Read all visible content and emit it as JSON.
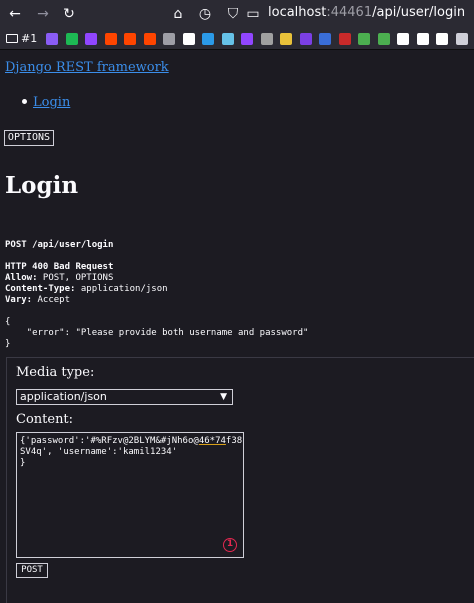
{
  "browser": {
    "url_host": "localhost",
    "url_port": ":44461",
    "url_path": "/api/user/login",
    "bookmark_folder": "#1",
    "favicon_colors": [
      "#8a5cf5",
      "#1db954",
      "#9146ff",
      "#ff4500",
      "#ff4500",
      "#ff4500",
      "#9e9ea6",
      "#ffffff",
      "#2b9ae8",
      "#66c2e8",
      "#9146ff",
      "#a0a0a0",
      "#e8c13a",
      "#7b3fe4",
      "#3a6ed8",
      "#c92a2a",
      "#4caf50",
      "#4caf50",
      "#ffffff",
      "#ffffff",
      "#ffffff",
      "#cfcfd8"
    ]
  },
  "page": {
    "brand": "Django REST framework",
    "breadcrumb": "Login",
    "options_button": "OPTIONS",
    "title": "Login",
    "request_line": "POST /api/user/login",
    "status_line": "HTTP 400 Bad Request",
    "headers": [
      {
        "key": "Allow:",
        "value": " POST, OPTIONS"
      },
      {
        "key": "Content-Type:",
        "value": " application/json"
      },
      {
        "key": "Vary:",
        "value": " Accept"
      }
    ],
    "body_open": "{",
    "body_line": "    \"error\": \"Please provide both username and password\"",
    "body_close": "}"
  },
  "form": {
    "media_type_label": "Media type:",
    "media_type_value": "application/json",
    "content_label": "Content:",
    "content_line1_a": "{'password':'#%RFzv@2BLYM&#jNh6o@",
    "content_line1_hl": "46*74",
    "content_line1_b": "f38",
    "content_line2": "SV4q', 'username':'kamil1234'",
    "content_line3": "}",
    "error_badge": "1",
    "post_button": "POST"
  }
}
